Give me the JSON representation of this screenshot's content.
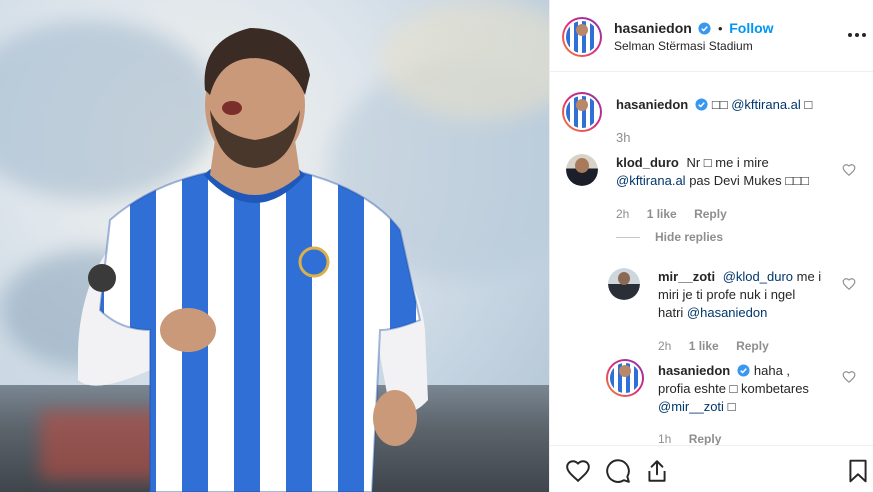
{
  "post": {
    "author": "hasaniedon",
    "follow_label": "Follow",
    "separator": "•",
    "location": "Selman Stërmasi Stadium"
  },
  "caption": {
    "name": "hasaniedon",
    "text_prefix": "□□",
    "mention": "@kftirana.al",
    "text_suffix": "□",
    "time": "3h"
  },
  "comments": [
    {
      "name": "klod_duro",
      "line1": "Nr □ me i mire",
      "mention": "@kftirana.al",
      "line2": "pas Devi Mukes □□□",
      "time": "2h",
      "likes": "1 like",
      "reply": "Reply",
      "hide_replies": "Hide replies"
    }
  ],
  "replies": [
    {
      "name": "mir__zoti",
      "mention1": "@klod_duro",
      "line1_rest": "me i",
      "line2": "miri je ti profe nuk i ngel",
      "line3_prefix": "hatri",
      "mention2": "@hasaniedon",
      "time": "2h",
      "likes": "1 like",
      "reply": "Reply"
    },
    {
      "name": "hasaniedon",
      "line1_rest": "haha ,",
      "line2": "profia eshte □ kombetares",
      "mention": "@mir__zoti",
      "line3_suffix": "□",
      "time": "1h",
      "reply": "Reply"
    }
  ],
  "icons": {
    "like": "heart-icon",
    "comment": "comment-icon",
    "share": "share-icon",
    "save": "bookmark-icon",
    "more": "more-icon",
    "verified": "verified-badge-icon"
  },
  "colors": {
    "accent": "#0095f6",
    "mention": "#00376b",
    "muted": "#8e8e8e",
    "jersey_blue": "#2f6fd6"
  }
}
